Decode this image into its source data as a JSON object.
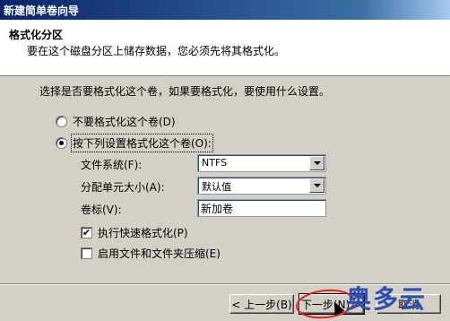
{
  "window": {
    "title": "新建简单卷向导"
  },
  "header": {
    "title": "格式化分区",
    "subtitle": "要在这个磁盘分区上储存数据，您必须先将其格式化。"
  },
  "content": {
    "question": "选择是否要格式化这个卷，如果要格式化，要使用什么设置。",
    "radio_no_format": "不要格式化这个卷(D)",
    "radio_format": "按下列设置格式化这个卷(O):",
    "fields": {
      "filesystem_label": "文件系统(F):",
      "filesystem_value": "NTFS",
      "allocation_label": "分配单元大小(A):",
      "allocation_value": "默认值",
      "volume_label_label": "卷标(V):",
      "volume_label_value": "新加卷"
    },
    "quick_format_label": "执行快速格式化(P)",
    "quick_format_checked": "✔",
    "compression_label": "启用文件和文件夹压缩(E)"
  },
  "buttons": {
    "back": "< 上一步(B)",
    "next": "下一步(N) >",
    "cancel": "取消"
  },
  "watermark": "奥多云"
}
